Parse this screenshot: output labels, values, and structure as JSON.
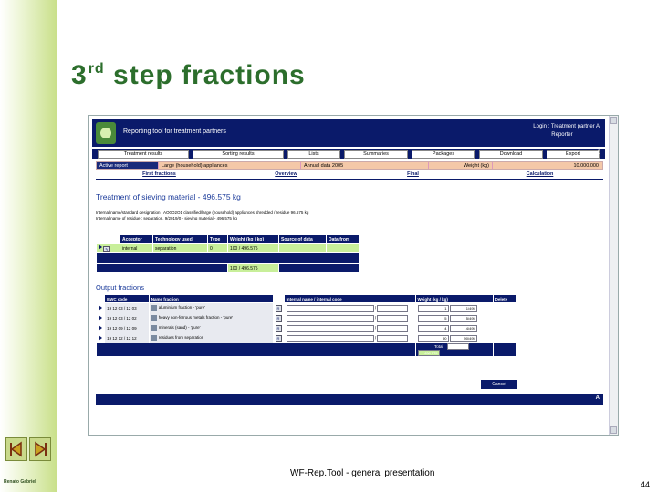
{
  "slide": {
    "title_main": "3",
    "title_sup": "rd",
    "title_rest": " step fractions",
    "footer": "WF-Rep.Tool - general presentation",
    "page_number": "44",
    "credit": "Renato Gabriel"
  },
  "app": {
    "name": "Reporting tool for treatment partners",
    "login": "Login : Treatment partner A",
    "login_sub": "Reporter",
    "menu": [
      {
        "label": "Treatment results",
        "w": 100
      },
      {
        "label": "Sorting results",
        "w": 100
      },
      {
        "label": "Lists",
        "w": 58
      },
      {
        "label": "Summaries",
        "w": 70
      },
      {
        "label": "Packages",
        "w": 70
      },
      {
        "label": "Download",
        "w": 70
      },
      {
        "label": "Export",
        "w": 58
      }
    ],
    "menu_corner": "0",
    "info": {
      "label_active": "Active report",
      "appliance": "Large (household) appliances",
      "period": "Annual data 2005",
      "weight_label": "Weight (kg)",
      "weight_value": "10.000.000"
    },
    "tabs": [
      "First fractions",
      "Overview",
      "Final",
      "Calculation"
    ]
  },
  "treatment": {
    "title": "Treatment of sieving material - 496.575 kg",
    "desc_line1": "Internal name/standard designation : AO0O2O1 classified/large (household) appliances shredded / residue 96.575 kg",
    "desc_line2": "Internal name of residue : separation, 9/2019/0 - sieving material - 496.575 kg",
    "headers": [
      "Acceptor",
      "Technology used",
      "Type",
      "Weight (kg / kg)",
      "Source of data",
      "Data from"
    ],
    "row": {
      "acceptor": "internal",
      "technology": "separation",
      "type": "0",
      "weight": "100 / 496.575"
    },
    "total": "100 / 496.575"
  },
  "output": {
    "title": "Output fractions",
    "headers": [
      "EWC code",
      "Name fraction",
      "Internal name / internal code",
      "Weight (kg / kg)",
      "Delete"
    ],
    "rows": [
      {
        "ewc": "19 12 03 / 12 03",
        "name": "aluminium fraction - 'pure'",
        "weight": "1",
        "weight2": "1/495"
      },
      {
        "ewc": "19 12 03 / 12 02",
        "name": "heavy non-ferrous metals fraction - 'pure'",
        "weight": "5",
        "weight2": "5/495"
      },
      {
        "ewc": "19 12 09 / 12 09",
        "name": "minerals (sand) - 'pure'",
        "weight": "4",
        "weight2": "4/495"
      },
      {
        "ewc": "19 12 12 / 12 12",
        "name": "residues from separation",
        "weight": "90",
        "weight2": "90/495"
      }
    ],
    "total_label": "Total",
    "total_value": "100.000",
    "total_weight": "496.575",
    "cancel": "Cancel",
    "bottom_letter": "A"
  },
  "colors": {
    "navy": "#0a1a6a",
    "title_green": "#2c6e2c",
    "light_green": "#c8ef9a",
    "salmon": "#f4c8a8"
  }
}
